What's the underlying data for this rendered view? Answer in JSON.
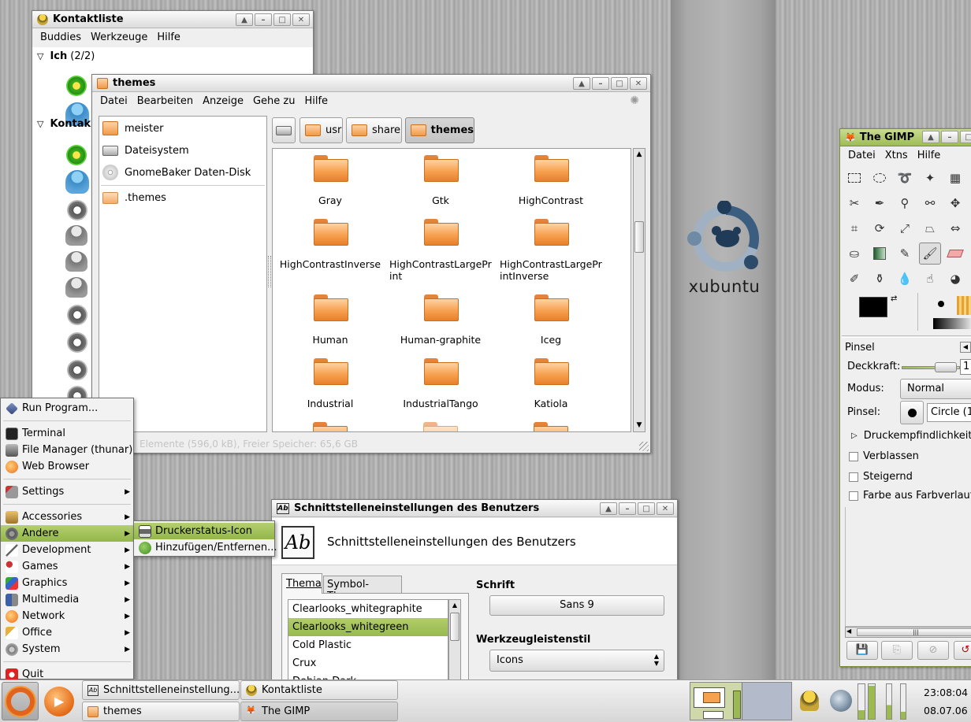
{
  "contacts_window": {
    "title": "Kontaktliste",
    "menu": [
      "Buddies",
      "Werkzeuge",
      "Hilfe"
    ],
    "groups": [
      {
        "label": "Ich",
        "count": "(2/2)"
      },
      {
        "label": "Kontak"
      }
    ]
  },
  "file_manager": {
    "title": "themes",
    "menu": [
      "Datei",
      "Bearbeiten",
      "Anzeige",
      "Gehe zu",
      "Hilfe"
    ],
    "sidebar": [
      "meister",
      "Dateisystem",
      "GnomeBaker Daten-Disk",
      ".themes"
    ],
    "path": [
      "usr",
      "share",
      "themes"
    ],
    "folders": [
      "Gray",
      "Gtk",
      "HighContrast",
      "HighContrastInverse",
      "HighContrastLargePrint",
      "HighContrastLargePrintInverse",
      "Human",
      "Human-graphite",
      "Iceg",
      "Industrial",
      "IndustrialTango",
      "Katiola"
    ],
    "status": "Elemente (596,0 kB), Freier Speicher: 65,6 GB"
  },
  "app_menu": {
    "items": [
      "Run Program...",
      "Terminal",
      "File Manager (thunar)",
      "Web Browser",
      "Settings",
      "Accessories",
      "Andere",
      "Development",
      "Games",
      "Graphics",
      "Multimedia",
      "Network",
      "Office",
      "System",
      "Quit"
    ],
    "submenu": [
      "Druckerstatus-Icon",
      "Hinzufügen/Entfernen..."
    ]
  },
  "settings_window": {
    "title": "Schnittstelleneinstellungen des Benutzers",
    "heading": "Schnittstelleneinstellungen des Benutzers",
    "tabs": [
      "Thema",
      "Symbol-Thema"
    ],
    "themes": [
      "Clearlooks_whitegraphite",
      "Clearlooks_whitegreen",
      "Cold Plastic",
      "Crux",
      "Debian Dark"
    ],
    "font_label": "Schrift",
    "font_value": "Sans 9",
    "toolbar_label": "Werkzeugleistenstil",
    "toolbar_value": "Icons"
  },
  "gimp": {
    "title": "The GIMP",
    "menu": [
      "Datei",
      "Xtns",
      "Hilfe"
    ],
    "section": "Pinsel",
    "opacity_label": "Deckkraft:",
    "opacity_value": "1",
    "mode_label": "Modus:",
    "mode_value": "Normal",
    "brush_label": "Pinsel:",
    "brush_value": "Circle (1",
    "pressure": "Druckempfindlichkeit",
    "options": [
      "Verblassen",
      "Steigernd",
      "Farbe aus Farbverlauf"
    ]
  },
  "logo_text": "xubuntu",
  "taskbar": {
    "tasks": [
      "Schnittstelleneinstellung...",
      "Kontaktliste",
      "themes",
      "The GIMP"
    ],
    "time": "23:08:04",
    "date": "08.07.06"
  },
  "colors": {
    "accent": "#9bbb52",
    "folder": "#f29c4b",
    "logo": "#1f3b57"
  }
}
